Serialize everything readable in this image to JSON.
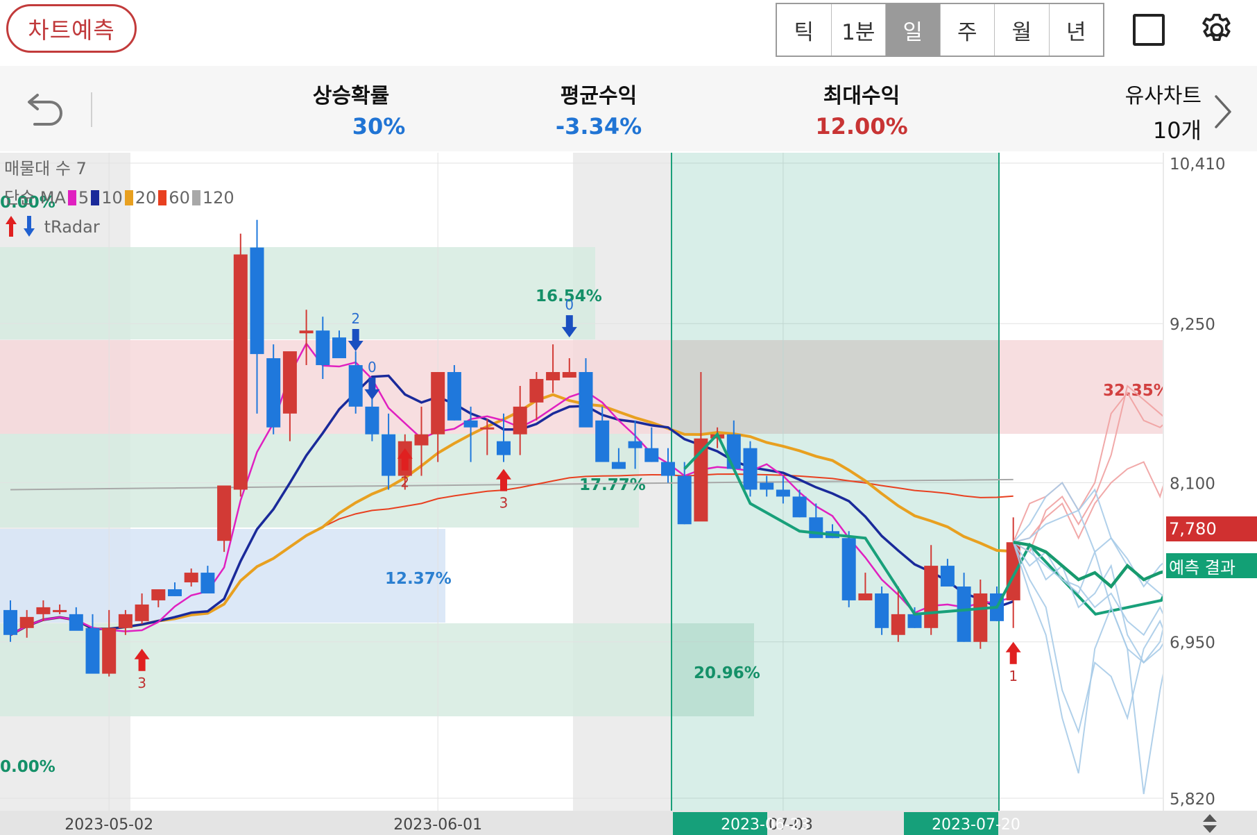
{
  "header": {
    "predict_button": "차트예측",
    "periods": [
      "틱",
      "1분",
      "일",
      "주",
      "월",
      "년"
    ],
    "active_period": "일"
  },
  "stats": {
    "rise_prob_label": "상승확률",
    "rise_prob_value": "30%",
    "avg_return_label": "평균수익",
    "avg_return_value": "-3.34%",
    "max_return_label": "최대수익",
    "max_return_value": "12.00%",
    "similar_label": "유사차트",
    "similar_value": "10개"
  },
  "colors": {
    "blue": "#2074d4",
    "red": "#c83434",
    "green": "#129a6e",
    "brand": "#c0393b"
  },
  "legend": {
    "line1": "매물대 수 7",
    "ma_prefix": "단순 MA",
    "ma": [
      {
        "period": "5",
        "color": "#e020c0"
      },
      {
        "period": "10",
        "color": "#1a2a9a"
      },
      {
        "period": "20",
        "color": "#e8a020"
      },
      {
        "period": "60",
        "color": "#e84020"
      },
      {
        "period": "120",
        "color": "#a8a8a8"
      }
    ],
    "radar": "tRadar"
  },
  "chart_data": {
    "type": "candlestick",
    "y_ticks": [
      "10,410",
      "9,250",
      "8,100",
      "6,950",
      "5,820"
    ],
    "ylim": [
      5820,
      10410
    ],
    "x_ticks": [
      {
        "label": "2023-05-02",
        "index": 6
      },
      {
        "label": "2023-06-01",
        "index": 26
      },
      {
        "label": "3-07-03",
        "index": 47
      }
    ],
    "highlight_dates": [
      "2023-06-23",
      "2023-07-20"
    ],
    "current_price": "7,780",
    "prediction_label": "예측 결과",
    "candles": [
      [
        7180,
        7250,
        6950,
        7000
      ],
      [
        7050,
        7180,
        6980,
        7130
      ],
      [
        7150,
        7250,
        7100,
        7200
      ],
      [
        7170,
        7220,
        7150,
        7180
      ],
      [
        7150,
        7200,
        7050,
        7030
      ],
      [
        7050,
        7150,
        6750,
        6720
      ],
      [
        6720,
        7180,
        6700,
        7050
      ],
      [
        7050,
        7180,
        7000,
        7150
      ],
      [
        7100,
        7300,
        7080,
        7220
      ],
      [
        7250,
        7330,
        7200,
        7330
      ],
      [
        7330,
        7380,
        7280,
        7280
      ],
      [
        7380,
        7480,
        7350,
        7450
      ],
      [
        7450,
        7500,
        7350,
        7300
      ],
      [
        7680,
        8000,
        7600,
        8080
      ],
      [
        8050,
        9900,
        8000,
        9750
      ],
      [
        9800,
        10000,
        8600,
        9030
      ],
      [
        9000,
        9100,
        8450,
        8500
      ],
      [
        8600,
        9000,
        8400,
        9050
      ],
      [
        9180,
        9350,
        8950,
        9200
      ],
      [
        9200,
        9300,
        8850,
        8950
      ],
      [
        9150,
        9200,
        9050,
        9000
      ],
      [
        8950,
        9050,
        8600,
        8650
      ],
      [
        8650,
        8800,
        8400,
        8450
      ],
      [
        8450,
        8600,
        8050,
        8150
      ],
      [
        8150,
        8450,
        8050,
        8400
      ],
      [
        8370,
        8650,
        8150,
        8450
      ],
      [
        8450,
        8900,
        8250,
        8900
      ],
      [
        8900,
        8950,
        8550,
        8550
      ],
      [
        8550,
        8650,
        8250,
        8500
      ],
      [
        8500,
        8560,
        8300,
        8500
      ],
      [
        8400,
        8600,
        8250,
        8300
      ],
      [
        8450,
        8800,
        8300,
        8650
      ],
      [
        8680,
        8900,
        8550,
        8850
      ],
      [
        8840,
        9100,
        8750,
        8900
      ],
      [
        8860,
        9000,
        8860,
        8900
      ],
      [
        8900,
        9000,
        8550,
        8500
      ],
      [
        8550,
        8650,
        8300,
        8250
      ],
      [
        8250,
        8350,
        8200,
        8200
      ],
      [
        8400,
        8550,
        8200,
        8350
      ],
      [
        8350,
        8500,
        8250,
        8250
      ],
      [
        8250,
        8350,
        8100,
        8150
      ],
      [
        8150,
        8250,
        7800,
        7800
      ],
      [
        7820,
        8900,
        7850,
        8420
      ],
      [
        8420,
        8500,
        8350,
        8450
      ],
      [
        8450,
        8550,
        8200,
        8200
      ],
      [
        8350,
        8400,
        8000,
        8050
      ],
      [
        8100,
        8150,
        8000,
        8050
      ],
      [
        8050,
        8150,
        7950,
        8000
      ],
      [
        8000,
        8050,
        7850,
        7850
      ],
      [
        7850,
        7950,
        7750,
        7700
      ],
      [
        7750,
        7800,
        7700,
        7700
      ],
      [
        7700,
        7750,
        7200,
        7250
      ],
      [
        7250,
        7450,
        7250,
        7300
      ],
      [
        7300,
        7350,
        7000,
        7050
      ],
      [
        7000,
        7350,
        6950,
        7150
      ],
      [
        7150,
        7200,
        7050,
        7050
      ],
      [
        7050,
        7650,
        7000,
        7500
      ],
      [
        7500,
        7550,
        7350,
        7350
      ],
      [
        7350,
        7450,
        6950,
        6950
      ],
      [
        6950,
        7400,
        6900,
        7300
      ],
      [
        7300,
        7350,
        7100,
        7100
      ],
      [
        7250,
        7850,
        7050,
        7670
      ]
    ]
  }
}
